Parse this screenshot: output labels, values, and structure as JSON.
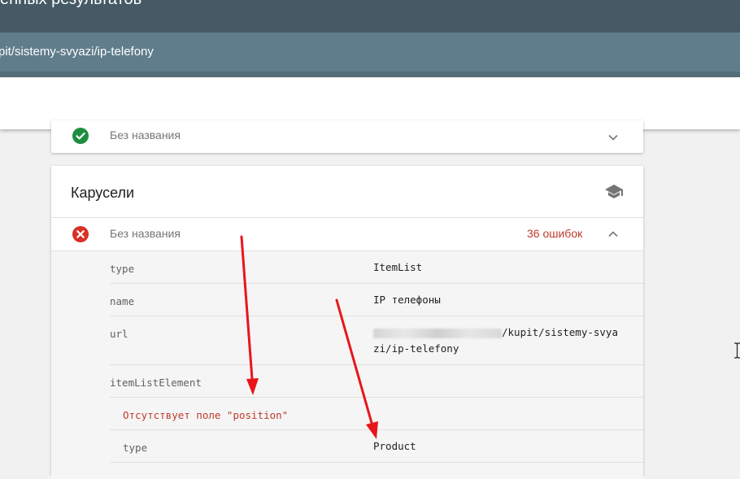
{
  "header": {
    "title": "енных результатов"
  },
  "url_bar": {
    "path": "pit/sistemy-svyazi/ip-telefony"
  },
  "card_prev": {
    "item_label": "Без названия"
  },
  "carousel_card": {
    "title": "Карусели",
    "item": {
      "label": "Без названия",
      "error_count": "36 ошибок"
    },
    "properties": [
      {
        "key": "type",
        "value": "ItemList"
      },
      {
        "key": "name",
        "value": "IP телефоны"
      },
      {
        "key": "url",
        "value_line1": "/kupit/sistemy-svya",
        "value_line2": "zi/ip-telefony"
      },
      {
        "key": "itemListElement",
        "value": ""
      },
      {
        "error": "Отсутствует поле \"position\""
      },
      {
        "key": "type",
        "value": "Product"
      }
    ]
  },
  "colors": {
    "header_bg": "#455a64",
    "url_bar_bg": "#607d8b",
    "success_green": "#1e8e3e",
    "error_red": "#d93025",
    "annotation_arrow": "#e8161a"
  },
  "icons": [
    "check-circle-icon",
    "chevron-down-icon",
    "graduation-cap-icon",
    "error-circle-icon",
    "chevron-up-icon",
    "text-cursor-icon"
  ]
}
